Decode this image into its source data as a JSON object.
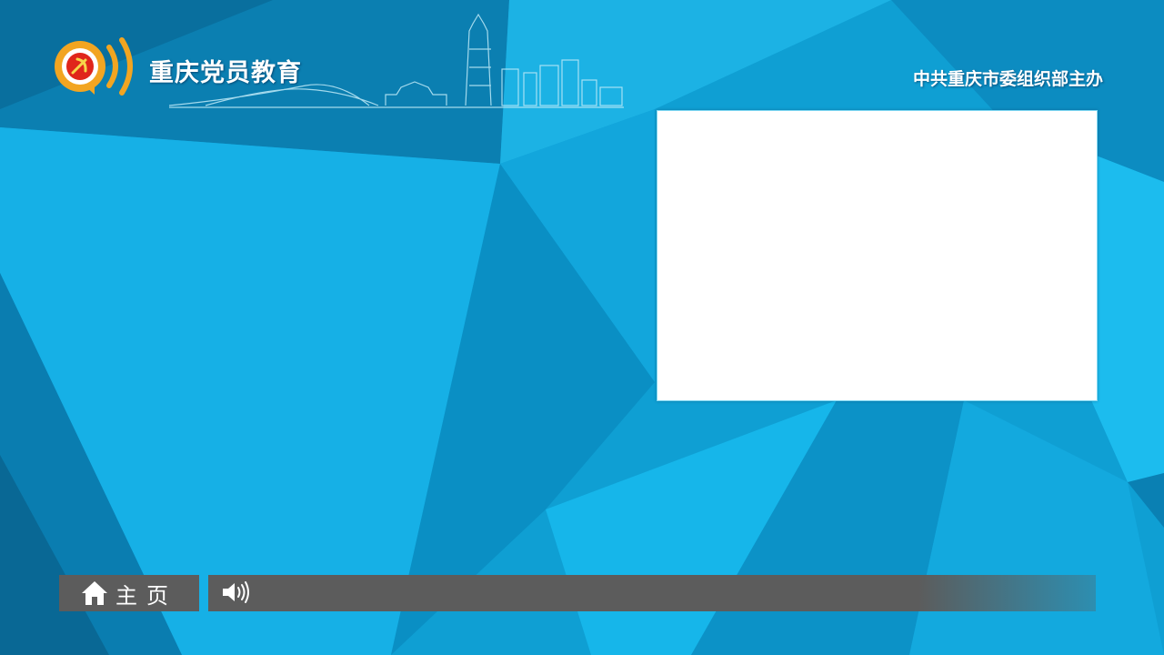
{
  "header": {
    "brand_title": "重庆党员教育",
    "organizer": "中共重庆市委组织部主办",
    "logo_icon": "party-emblem-broadcast-icon"
  },
  "video": {
    "state": "blank"
  },
  "footer": {
    "home_label": "主页",
    "home_icon": "home-icon",
    "speaker_icon": "speaker-icon",
    "ticker_text": ""
  },
  "colors": {
    "background": "#10a6d8",
    "bar": "#5c5c5c",
    "text": "#ffffff",
    "logo_gold": "#f2a521",
    "emblem_red": "#e0261b"
  }
}
